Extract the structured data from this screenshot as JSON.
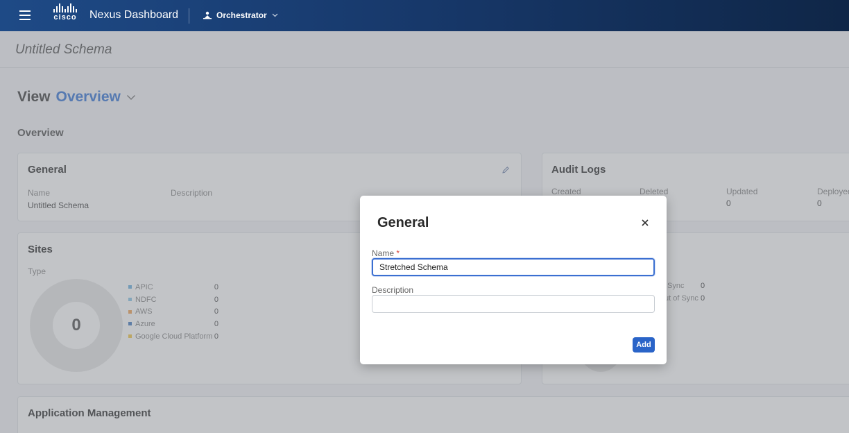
{
  "topbar": {
    "brand": "cisco",
    "app_title": "Nexus Dashboard",
    "service": "Orchestrator"
  },
  "page": {
    "schema_title": "Untitled Schema",
    "view_label": "View",
    "view_value": "Overview",
    "section_title": "Overview"
  },
  "general_card": {
    "title": "General",
    "name_label": "Name",
    "name_value": "Untitled Schema",
    "description_label": "Description"
  },
  "audit_card": {
    "title": "Audit Logs",
    "columns": [
      {
        "label": "Created",
        "value": ""
      },
      {
        "label": "Deleted",
        "value": ""
      },
      {
        "label": "Updated",
        "value": "0"
      },
      {
        "label": "Deployed",
        "value": "0"
      }
    ]
  },
  "sites_card": {
    "title": "Sites",
    "type_label": "Type",
    "total": "0",
    "legend": [
      {
        "name": "APIC",
        "count": "0",
        "color": "#6fb2e0"
      },
      {
        "name": "NDFC",
        "count": "0",
        "color": "#8cc6e8"
      },
      {
        "name": "AWS",
        "count": "0",
        "color": "#f0a55a"
      },
      {
        "name": "Azure",
        "count": "0",
        "color": "#4a7fc2"
      },
      {
        "name": "Google Cloud Platform",
        "count": "0",
        "color": "#f2c94c"
      }
    ]
  },
  "status_card": {
    "rows": [
      {
        "label": "Sync",
        "count": "0"
      },
      {
        "label": "ut of Sync",
        "count": "0"
      }
    ]
  },
  "app_mgmt_card": {
    "title": "Application Management"
  },
  "modal": {
    "title": "General",
    "name_label": "Name",
    "required_mark": "*",
    "name_value": "Stretched Schema",
    "description_label": "Description",
    "description_value": "",
    "add_label": "Add"
  }
}
